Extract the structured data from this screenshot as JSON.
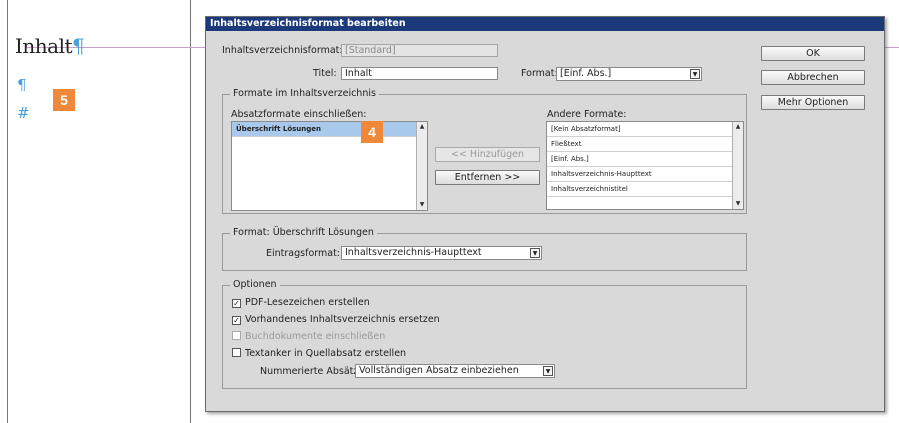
{
  "document": {
    "heading": "Inhalt",
    "pilcrow": "¶",
    "hash": "#",
    "badge_5": "5"
  },
  "dialog": {
    "title": "Inhaltsverzeichnisformat bearbeiten",
    "toc_format_label": "Inhaltsverzeichnisformat:",
    "toc_format_value": "[Standard]",
    "title_label": "Titel:",
    "title_value": "Inhalt",
    "format_label": "Format:",
    "format_value": "[Einf. Abs.]",
    "buttons": {
      "ok": "OK",
      "cancel": "Abbrechen",
      "more_options": "Mehr Optionen",
      "add": "<< Hinzufügen",
      "remove": "Entfernen >>"
    },
    "styles_group": {
      "legend": "Formate im Inhaltsverzeichnis",
      "include_label": "Absatzformate einschließen:",
      "included": [
        "Überschrift Lösungen"
      ],
      "other_label": "Andere Formate:",
      "other": [
        "[Kein Absatzformat]",
        "Fließtext",
        "[Einf. Abs.]",
        "Inhaltsverzeichnis-Haupttext",
        "Inhaltsverzeichnistitel"
      ],
      "badge_4": "4"
    },
    "style_group": {
      "legend": "Format: Überschrift Lösungen",
      "entry_label": "Eintragsformat:",
      "entry_value": "Inhaltsverzeichnis-Haupttext"
    },
    "options_group": {
      "legend": "Optionen",
      "options": [
        {
          "label": "PDF-Lesezeichen erstellen",
          "checked": "✓"
        },
        {
          "label": "Vorhandenes Inhaltsverzeichnis ersetzen",
          "checked": "✓"
        },
        {
          "label": "Buchdokumente einschließen",
          "checked": ""
        },
        {
          "label": "Textanker in Quellabsatz erstellen",
          "checked": ""
        }
      ],
      "numbered_label": "Nummerierte Absätze:",
      "numbered_value": "Vollständigen Absatz einbeziehen"
    },
    "icons": {
      "dropdown": "▼",
      "scroll_up": "▲",
      "scroll_down": "▼"
    }
  }
}
